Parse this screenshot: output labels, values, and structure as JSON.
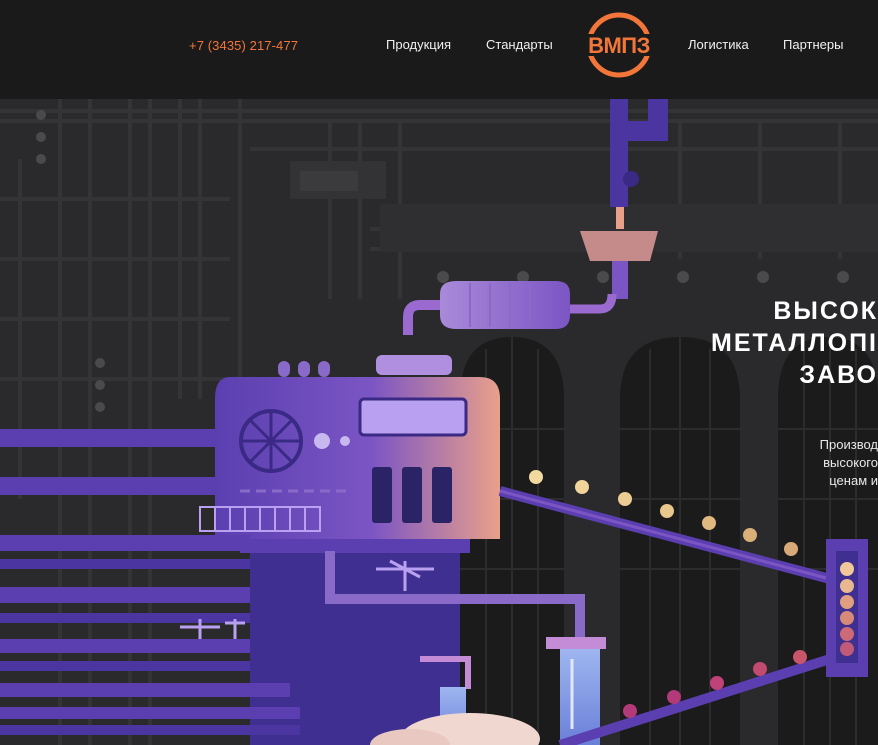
{
  "header": {
    "phone": "+7 (3435) 217-477",
    "nav_left": [
      "Продукция",
      "Стандарты"
    ],
    "logo_text": "ВМПЗ",
    "nav_right": [
      "Логистика",
      "Партнеры"
    ]
  },
  "hero": {
    "title_lines": [
      "ВЫСОК",
      "МЕТАЛЛОПІ",
      "ЗАВО"
    ],
    "subtitle_lines": [
      "Производ",
      "высокого",
      "ценам и"
    ]
  },
  "colors": {
    "accent": "#f2763a",
    "header_bg": "#1a1a1a",
    "hero_bg": "#2a2a2c",
    "machine_purple": "#5b3fb0",
    "machine_light": "#c48bd6"
  }
}
